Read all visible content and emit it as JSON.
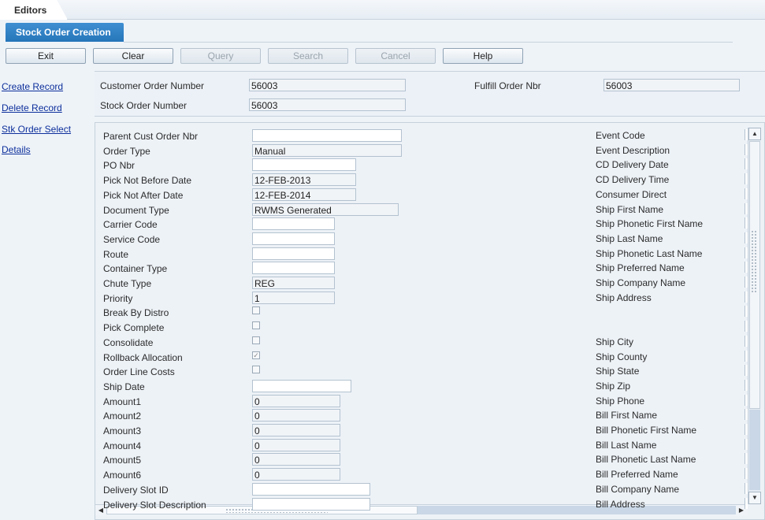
{
  "tabs": {
    "editors": "Editors"
  },
  "title": "Stock Order Creation",
  "toolbar": [
    {
      "label": "Exit",
      "enabled": true
    },
    {
      "label": "Clear",
      "enabled": true
    },
    {
      "label": "Query",
      "enabled": false
    },
    {
      "label": "Search",
      "enabled": false
    },
    {
      "label": "Cancel",
      "enabled": false
    },
    {
      "label": "Help",
      "enabled": true
    }
  ],
  "sidebar": [
    "Create Record",
    "Delete Record",
    "Stk Order Select",
    "Details"
  ],
  "header_fields": {
    "customer_order_number": {
      "label": "Customer Order Number",
      "value": "56003"
    },
    "fulfill_order_nbr": {
      "label": "Fulfill Order Nbr",
      "value": "56003"
    },
    "stock_order_number": {
      "label": "Stock Order Number",
      "value": "56003"
    }
  },
  "left_fields": [
    {
      "label": "Parent Cust Order Nbr",
      "value": "",
      "type": "text"
    },
    {
      "label": "Order Type",
      "value": "Manual",
      "type": "text"
    },
    {
      "label": "PO Nbr",
      "value": "",
      "type": "text"
    },
    {
      "label": "Pick Not Before Date",
      "value": "12-FEB-2013",
      "type": "text"
    },
    {
      "label": "Pick Not After Date",
      "value": "12-FEB-2014",
      "type": "text"
    },
    {
      "label": "Document Type",
      "value": "RWMS Generated",
      "type": "text"
    },
    {
      "label": "Carrier Code",
      "value": "",
      "type": "text"
    },
    {
      "label": "Service Code",
      "value": "",
      "type": "text"
    },
    {
      "label": "Route",
      "value": "",
      "type": "text"
    },
    {
      "label": "Container Type",
      "value": "",
      "type": "text"
    },
    {
      "label": "Chute Type",
      "value": "REG",
      "type": "text"
    },
    {
      "label": "Priority",
      "value": "1",
      "type": "text"
    },
    {
      "label": "Break By Distro",
      "checked": false,
      "type": "check"
    },
    {
      "label": "Pick Complete",
      "checked": false,
      "type": "check"
    },
    {
      "label": "Consolidate",
      "checked": false,
      "type": "check"
    },
    {
      "label": "Rollback Allocation",
      "checked": true,
      "type": "check"
    },
    {
      "label": "Order Line Costs",
      "checked": false,
      "type": "check"
    },
    {
      "label": "Ship Date",
      "value": "",
      "type": "text"
    },
    {
      "label": "Amount1",
      "value": "0",
      "type": "text"
    },
    {
      "label": "Amount2",
      "value": "0",
      "type": "text"
    },
    {
      "label": "Amount3",
      "value": "0",
      "type": "text"
    },
    {
      "label": "Amount4",
      "value": "0",
      "type": "text"
    },
    {
      "label": "Amount5",
      "value": "0",
      "type": "text"
    },
    {
      "label": "Amount6",
      "value": "0",
      "type": "text"
    },
    {
      "label": "Delivery Slot ID",
      "value": "",
      "type": "text"
    },
    {
      "label": "Delivery Slot Description",
      "value": "",
      "type": "text"
    }
  ],
  "right_fields": [
    "Event Code",
    "Event Description",
    "CD Delivery Date",
    "CD Delivery Time",
    "Consumer Direct",
    "Ship First Name",
    "Ship Phonetic First Name",
    "Ship Last Name",
    "Ship Phonetic Last Name",
    "Ship Preferred Name",
    "Ship Company Name",
    "Ship Address",
    "",
    "",
    "Ship City",
    "Ship County",
    "Ship State",
    "Ship Zip",
    "Ship Phone",
    "Bill First Name",
    "Bill Phonetic First Name",
    "Bill Last Name",
    "Bill Phonetic Last Name",
    "Bill Preferred Name",
    "Bill Company Name",
    "Bill Address"
  ],
  "icons": {
    "scroll_up": "arrow-up-icon",
    "scroll_down": "arrow-down-icon",
    "scroll_left": "arrow-left-icon",
    "scroll_right": "arrow-right-icon"
  }
}
